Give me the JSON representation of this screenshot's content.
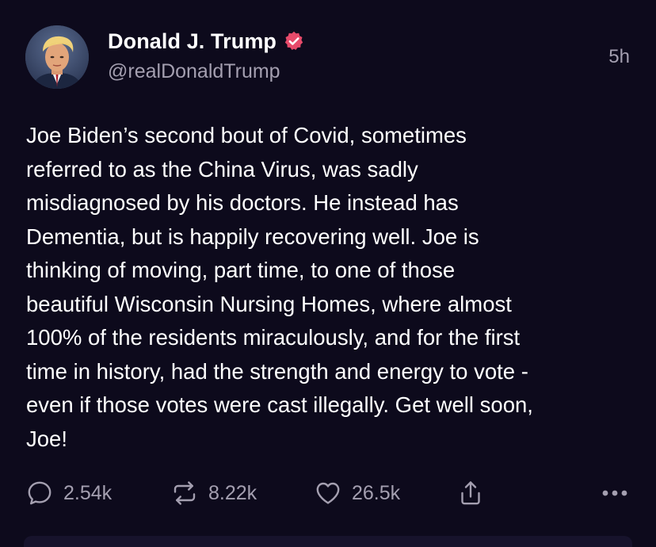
{
  "post": {
    "author": {
      "display_name": "Donald J. Trump",
      "handle": "@realDonaldTrump",
      "verified_icon": "verified-badge-icon",
      "avatar": "profile-photo"
    },
    "timestamp": "5h",
    "text": "Joe Biden’s second bout of Covid, sometimes\nreferred to as the China Virus, was sadly\nmisdiagnosed by his doctors. He instead has\nDementia, but is happily recovering well. Joe is\nthinking of moving, part time, to one of those\nbeautiful Wisconsin Nursing Homes, where almost\n100% of the residents miraculously, and for the first\ntime in history, had the strength and energy to vote -\neven if those votes were cast illegally. Get well soon,\nJoe!",
    "actions": {
      "replies": {
        "icon": "reply-icon",
        "count": "2.54k"
      },
      "reposts": {
        "icon": "repost-icon",
        "count": "8.22k"
      },
      "likes": {
        "icon": "heart-icon",
        "count": "26.5k"
      },
      "share": {
        "icon": "share-icon"
      },
      "more": {
        "icon": "more-icon"
      }
    }
  },
  "colors": {
    "background": "#0d0a1c",
    "text_primary": "#ffffff",
    "text_secondary": "#a49fb0",
    "verified_badge": "#e64a6a"
  }
}
